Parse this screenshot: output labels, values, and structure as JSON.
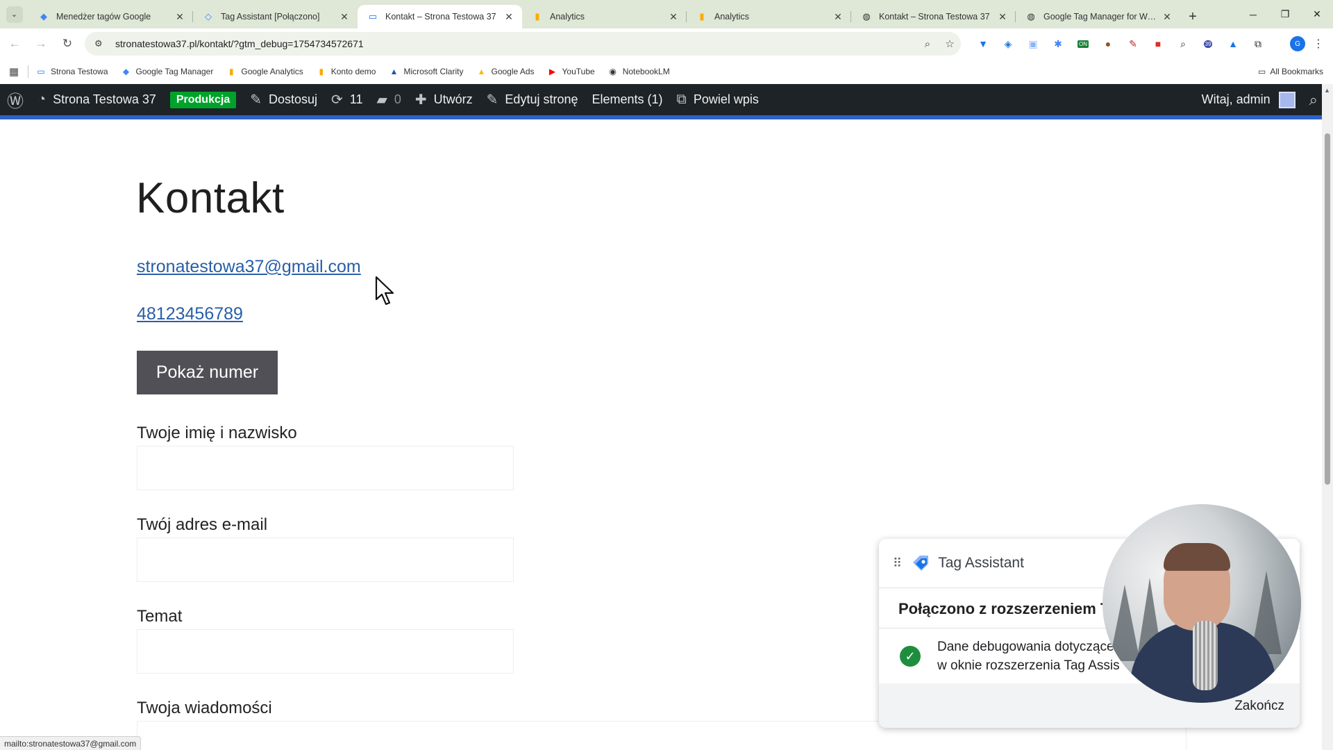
{
  "tabs": [
    {
      "title": "Menedżer tagów Google",
      "icon": "gtm-icon",
      "active": false
    },
    {
      "title": "Tag Assistant [Połączono]",
      "icon": "tag-assistant-icon",
      "active": false
    },
    {
      "title": "Kontakt – Strona Testowa 37",
      "icon": "wp-icon",
      "active": true
    },
    {
      "title": "Analytics",
      "icon": "analytics-icon",
      "active": false
    },
    {
      "title": "Analytics",
      "icon": "analytics-icon",
      "active": false
    },
    {
      "title": "Kontakt – Strona Testowa 37",
      "icon": "globe-icon",
      "active": false
    },
    {
      "title": "Google Tag Manager for WordPress",
      "icon": "globe-icon",
      "active": false
    }
  ],
  "address": {
    "url": "stronatestowa37.pl/kontakt/?gtm_debug=1754734572671"
  },
  "extensions": {
    "badge_on": "ON",
    "badge_count": "39",
    "profile_initial": "G"
  },
  "bookmarks": {
    "items": [
      "Strona Testowa",
      "Google Tag Manager",
      "Google Analytics",
      "Konto demo",
      "Microsoft Clarity",
      "Google Ads",
      "YouTube",
      "NotebookLM"
    ],
    "all_label": "All Bookmarks"
  },
  "adminbar": {
    "site_name": "Strona Testowa 37",
    "env_badge": "Produkcja",
    "customize": "Dostosuj",
    "updates_count": "11",
    "comments_count": "0",
    "new_label": "Utwórz",
    "edit_page": "Edytuj stronę",
    "elements": "Elements (1)",
    "duplicate": "Powiel wpis",
    "greeting": "Witaj, admin"
  },
  "page": {
    "title": "Kontakt",
    "email": "stronatestowa37@gmail.com",
    "phone": "48123456789",
    "show_number_button": "Pokaż numer",
    "form": {
      "name_label": "Twoje imię i nazwisko",
      "email_label": "Twój adres e-mail",
      "subject_label": "Temat",
      "message_label": "Twoja wiadomości"
    }
  },
  "tag_assistant": {
    "app_name": "Tag Assistant",
    "heading": "Połączono z rozszerzeniem Ta",
    "message_line1": "Dane debugowania dotyczące",
    "message_line2": "w oknie rozszerzenia Tag Assis",
    "finish_button": "Zakończ"
  },
  "status_bar": {
    "text": "mailto:stronatestowa37@gmail.com"
  },
  "colors": {
    "tabstrip": "#dfe7d7",
    "adminbar": "#1d2327",
    "badge_green": "#00a32a",
    "link_blue": "#285ea7",
    "button_dark": "#505056",
    "check_green": "#1e8e3e"
  }
}
